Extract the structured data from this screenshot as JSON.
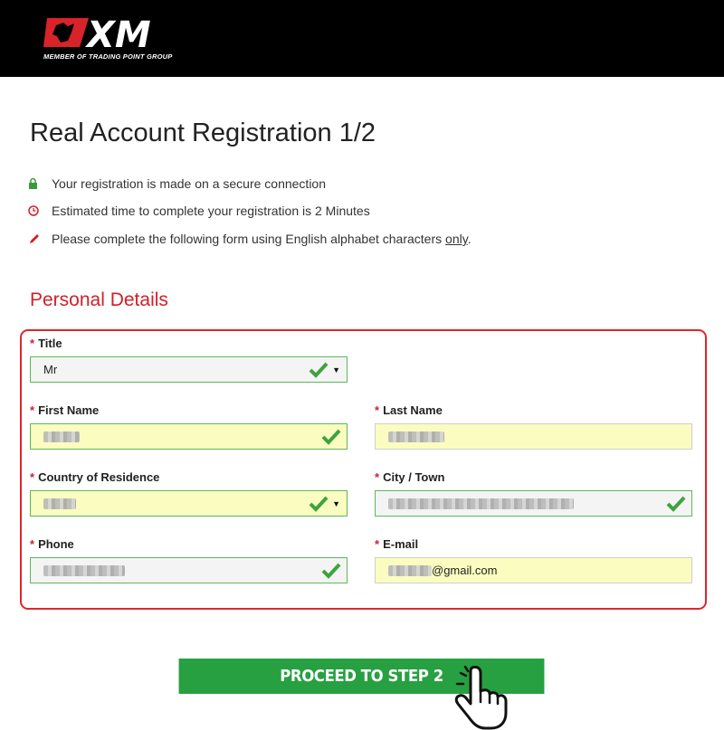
{
  "header": {
    "logo_text": "XM",
    "logo_subtitle": "MEMBER OF TRADING POINT GROUP"
  },
  "page": {
    "title": "Real Account Registration 1/2"
  },
  "info": [
    {
      "icon": "lock-icon",
      "text": "Your registration is made on a secure connection",
      "color": "#3a9a3a"
    },
    {
      "icon": "clock-icon",
      "text": "Estimated time to complete your registration is 2 Minutes",
      "color": "#d0202a"
    },
    {
      "icon": "pencil-icon",
      "text_before": "Please complete the following form using English alphabet characters ",
      "underlined": "only",
      "text_after": ".",
      "color": "#d0202a"
    }
  ],
  "form": {
    "section_title": "Personal Details",
    "required_mark": "*",
    "title_label": "Title",
    "title_value": "Mr",
    "first_name_label": "First Name",
    "last_name_label": "Last Name",
    "country_label": "Country of Residence",
    "city_label": "City / Town",
    "phone_label": "Phone",
    "email_label": "E-mail",
    "email_value_visible": "@gmail.com"
  },
  "actions": {
    "proceed_label": "PROCEED TO STEP 2"
  },
  "colors": {
    "accent_red": "#e0262d",
    "success_green": "#3ea33e",
    "button_green": "#27a041",
    "field_yellow": "#fbfdc0"
  }
}
